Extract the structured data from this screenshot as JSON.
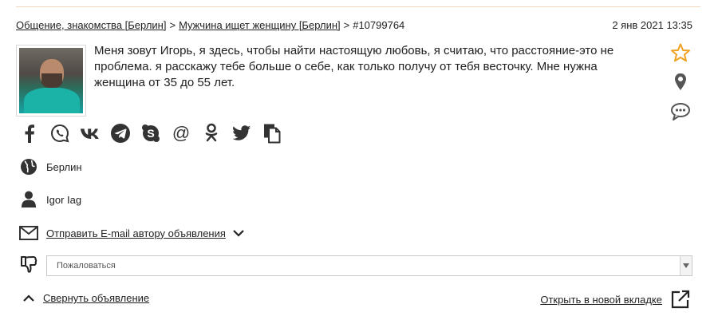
{
  "breadcrumb": {
    "items": [
      "Общение, знакомства [Берлин]",
      "Мужчина ищет женщину [Берлин]"
    ],
    "separator": ">",
    "ad_id": "#10799764"
  },
  "date": "2 янв 2021 13:35",
  "message": "Меня зовут Игорь, я здесь, чтобы найти настоящую любовь, я считаю, что расстояние-это не проблема. я расскажу тебе больше о себе, как только получу от тебя весточку. Мне нужна женщина от 35 до 55 лет.",
  "side_icons": [
    "star-icon",
    "location-pin-icon",
    "comment-icon"
  ],
  "social_icons": [
    "facebook-icon",
    "whatsapp-icon",
    "vk-icon",
    "telegram-icon",
    "skype-icon",
    "email-at-icon",
    "odnoklassniki-icon",
    "twitter-icon",
    "copy-icon"
  ],
  "details": {
    "city": "Берлин",
    "author": "Igor Iag",
    "email_link": "Отправить E-mail автору объявления"
  },
  "complain": {
    "placeholder": "Пожаловаться"
  },
  "footer": {
    "collapse_label": "Свернуть объявление",
    "open_new_tab_label": "Открыть в новой вкладке"
  },
  "colors": {
    "accent_orange": "#f0a020",
    "icon_dark": "#3a3a3a",
    "rule": "#f1d9be"
  }
}
